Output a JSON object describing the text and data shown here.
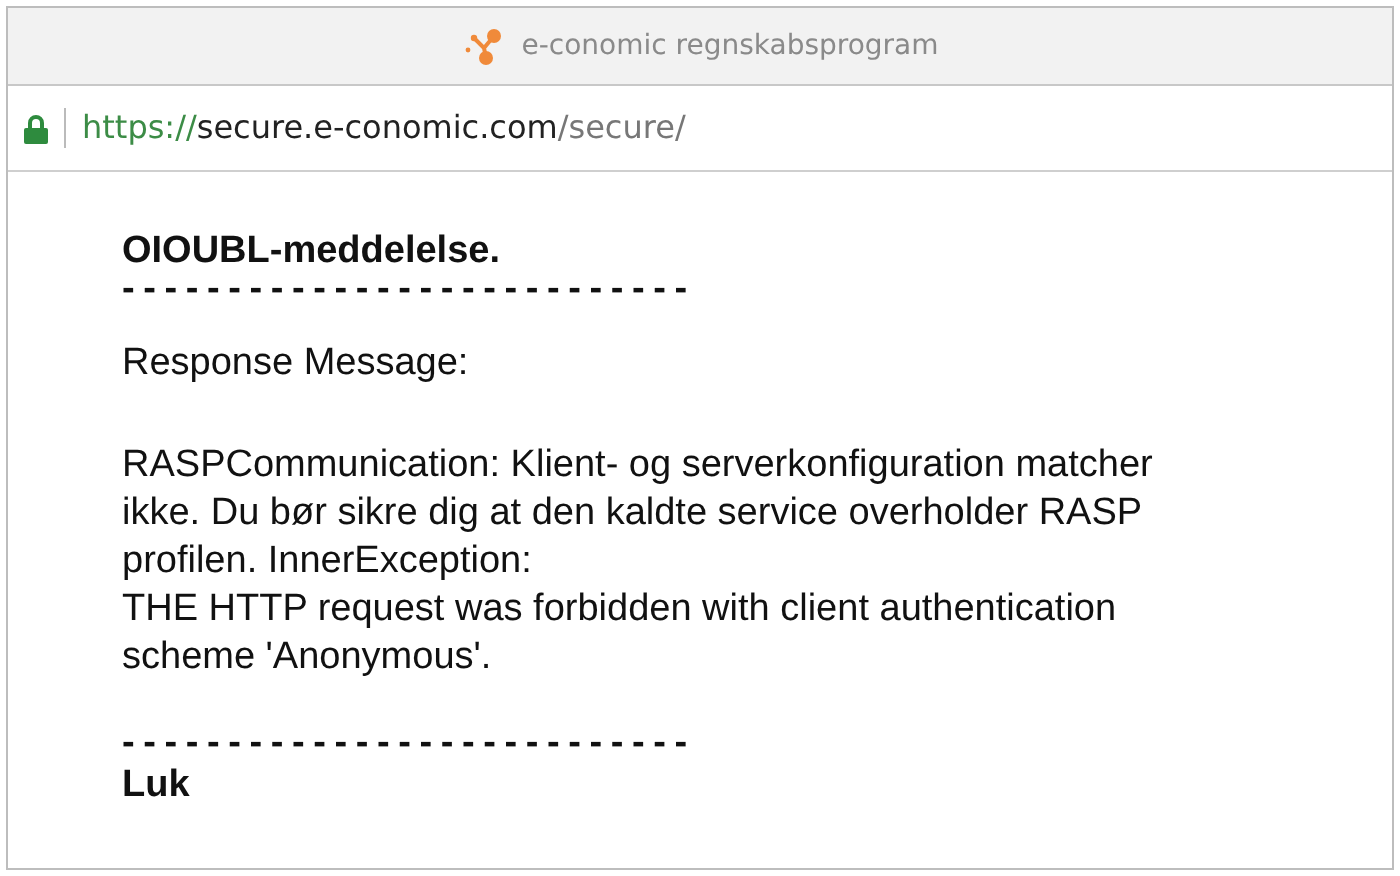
{
  "window": {
    "title": "e-conomic regnskabsprogram"
  },
  "address_bar": {
    "secure": true,
    "scheme": "https://",
    "host": "secure.e-conomic.com",
    "path": "/secure/"
  },
  "content": {
    "heading": "OIOUBL-meddelelse.",
    "separator_top": "---------------------------",
    "label": "Response Message:",
    "message": "RASPCommunication: Klient- og serverkonfiguration matcher ikke. Du bør sikre dig at den kaldte service overholder RASP profilen. InnerException:\nTHE HTTP request was forbidden with client authentication scheme 'Anonymous'.",
    "separator_bottom": "---------------------------",
    "close_link": "Luk"
  }
}
